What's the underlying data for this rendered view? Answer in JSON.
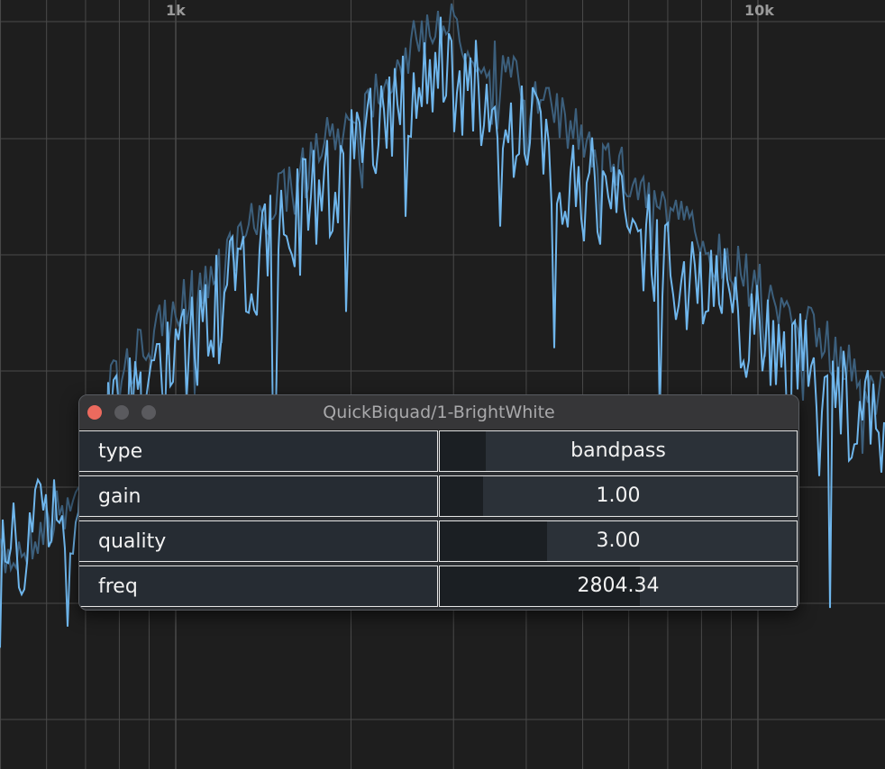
{
  "spectrum": {
    "freq_labels": [
      "1k",
      "10k"
    ],
    "line_colors": {
      "current": "#6fb6ec",
      "previous": "#3c5f7c",
      "grid": "#4a4a4a"
    }
  },
  "window": {
    "title": "QuickBiquad/1-BrightWhite",
    "buttons": [
      "close-icon",
      "minimize-icon",
      "zoom-icon"
    ]
  },
  "params": [
    {
      "label": "type",
      "value": "bandpass",
      "fill_fraction": 0.13
    },
    {
      "label": "gain",
      "value": "1.00",
      "fill_fraction": 0.12
    },
    {
      "label": "quality",
      "value": "3.00",
      "fill_fraction": 0.3
    },
    {
      "label": "freq",
      "value": "2804.34",
      "fill_fraction": 0.56
    }
  ]
}
